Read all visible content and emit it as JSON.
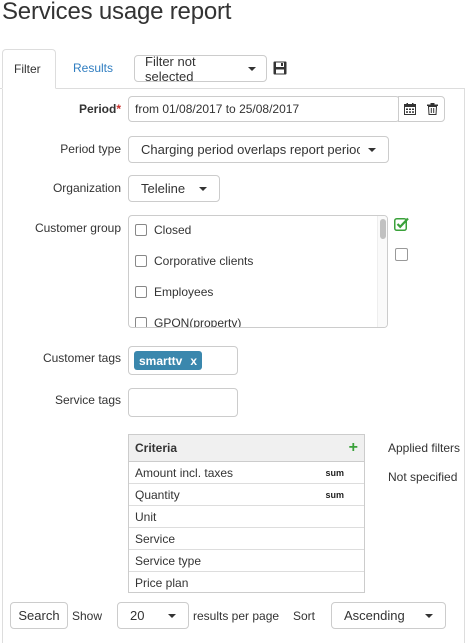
{
  "page": {
    "title": "Services usage report"
  },
  "tabs": {
    "filter": "Filter",
    "results": "Results"
  },
  "filter_select": {
    "value": "Filter not selected"
  },
  "form": {
    "period": {
      "label": "Period",
      "required_mark": "*",
      "value": "from 01/08/2017 to 25/08/2017"
    },
    "period_type": {
      "label": "Period type",
      "value": "Charging period overlaps report perioc"
    },
    "organization": {
      "label": "Organization",
      "value": "Teleline"
    },
    "customer_group": {
      "label": "Customer group",
      "options": [
        "Closed",
        "Corporative clients",
        "Employees",
        "GPON(property)"
      ]
    },
    "customer_tags": {
      "label": "Customer tags",
      "tag": "smarttv",
      "remove": "x"
    },
    "service_tags": {
      "label": "Service tags",
      "value": ""
    }
  },
  "criteria": {
    "header": "Criteria",
    "add": "+",
    "rows": [
      {
        "name": "Amount incl. taxes",
        "agg": "sum"
      },
      {
        "name": "Quantity",
        "agg": "sum"
      },
      {
        "name": "Unit",
        "agg": ""
      },
      {
        "name": "Service",
        "agg": ""
      },
      {
        "name": "Service type",
        "agg": ""
      },
      {
        "name": "Price plan",
        "agg": ""
      }
    ]
  },
  "applied_filters": {
    "title": "Applied filters",
    "value": "Not specified"
  },
  "bottom": {
    "search": "Search",
    "show": "Show",
    "per_page_value": "20",
    "per_page_label": "results per page",
    "sort_label": "Sort",
    "sort_value": "Ascending"
  },
  "colors": {
    "link": "#2f7dc0",
    "tag_bg": "#3a87ad",
    "required": "#c9302c",
    "check_green": "#3aa13a"
  }
}
